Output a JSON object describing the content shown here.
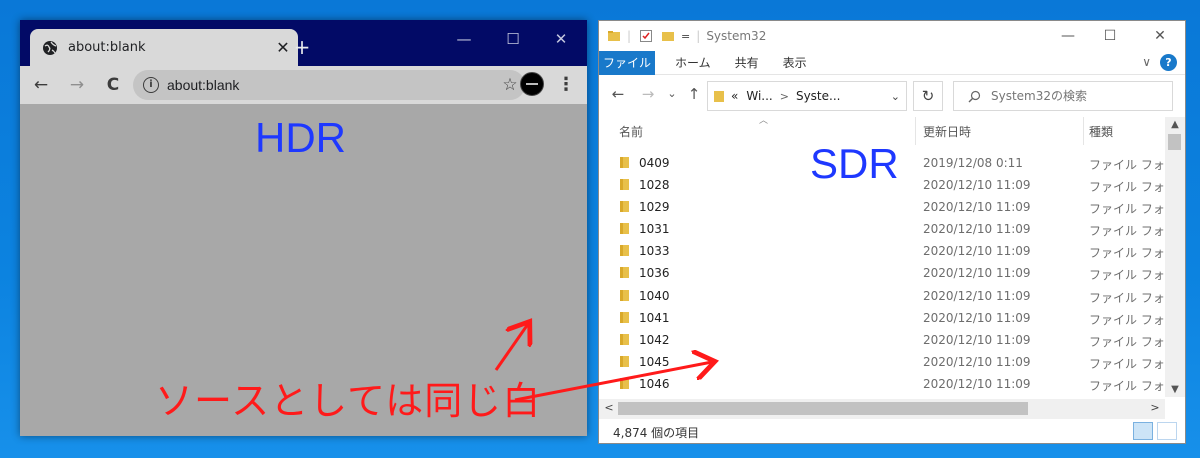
{
  "browser": {
    "tab_title": "about:blank",
    "tab_close": "✕",
    "new_tab": "+",
    "address": "about:blank",
    "minimize": "—",
    "maximize": "☐",
    "close": "✕",
    "back_icon": "←",
    "forward_icon": "→",
    "reload_icon": "C",
    "star_icon": "☆",
    "menu_icon": "⋮",
    "page_label": "HDR"
  },
  "explorer": {
    "title": "System32",
    "qa_pin": "=",
    "minimize": "—",
    "maximize": "☐",
    "close": "✕",
    "ribbon": {
      "file": "ファイル",
      "home": "ホーム",
      "share": "共有",
      "view": "表示",
      "collapse": "∨",
      "help": "?"
    },
    "nav": {
      "back": "←",
      "forward": "→",
      "recent": "⌄",
      "up": "↑",
      "refresh": "↻"
    },
    "address": {
      "chev": "«",
      "part1": "Wi...",
      "sep": ">",
      "part2": "Syste...",
      "dropdown": "⌄"
    },
    "search_placeholder": "System32の検索",
    "columns": {
      "name": "名前",
      "date": "更新日時",
      "type": "種類"
    },
    "rows": [
      {
        "name": "0409",
        "date": "2019/12/08 0:11",
        "type": "ファイル フォルダー"
      },
      {
        "name": "1028",
        "date": "2020/12/10 11:09",
        "type": "ファイル フォルダー"
      },
      {
        "name": "1029",
        "date": "2020/12/10 11:09",
        "type": "ファイル フォルダー"
      },
      {
        "name": "1031",
        "date": "2020/12/10 11:09",
        "type": "ファイル フォルダー"
      },
      {
        "name": "1033",
        "date": "2020/12/10 11:09",
        "type": "ファイル フォルダー"
      },
      {
        "name": "1036",
        "date": "2020/12/10 11:09",
        "type": "ファイル フォルダー"
      },
      {
        "name": "1040",
        "date": "2020/12/10 11:09",
        "type": "ファイル フォルダー"
      },
      {
        "name": "1041",
        "date": "2020/12/10 11:09",
        "type": "ファイル フォルダー"
      },
      {
        "name": "1042",
        "date": "2020/12/10 11:09",
        "type": "ファイル フォルダー"
      },
      {
        "name": "1045",
        "date": "2020/12/10 11:09",
        "type": "ファイル フォルダー"
      },
      {
        "name": "1046",
        "date": "2020/12/10 11:09",
        "type": "ファイル フォルダー"
      }
    ],
    "status_count": "4,874 個の項目",
    "page_label": "SDR"
  },
  "annotation": {
    "text": "ソースとしては同じ白",
    "color": "#ff1a1a"
  },
  "colors": {
    "hdr_sdr_label": "#1e38ff",
    "chrome_titlebar": "#020a66",
    "ribbon_file": "#1979ca",
    "desktop": "#0c83e0"
  }
}
